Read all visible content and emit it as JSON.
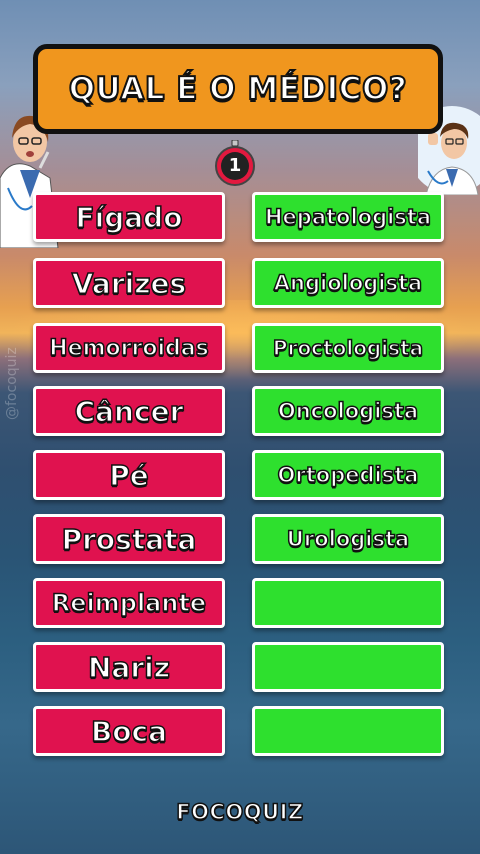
{
  "header": {
    "title": "QUAL É O MÉDICO?"
  },
  "timer": {
    "value": "1"
  },
  "watermark": "@focoquiz",
  "rows": [
    {
      "left": "Fígado",
      "right": "Hepatologista"
    },
    {
      "left": "Varizes",
      "right": "Angiologista"
    },
    {
      "left": "Hemorroidas",
      "right": "Proctologista"
    },
    {
      "left": "Câncer",
      "right": "Oncologista"
    },
    {
      "left": "Pé",
      "right": "Ortopedista"
    },
    {
      "left": "Prostata",
      "right": "Urologista"
    },
    {
      "left": "Reimplante",
      "right": ""
    },
    {
      "left": "Nariz",
      "right": ""
    },
    {
      "left": "Boca",
      "right": ""
    }
  ],
  "brand": "FOCOQUIZ",
  "colors": {
    "left_button": "#e0124f",
    "right_button": "#2ee02e",
    "title_box": "#f0961e"
  }
}
